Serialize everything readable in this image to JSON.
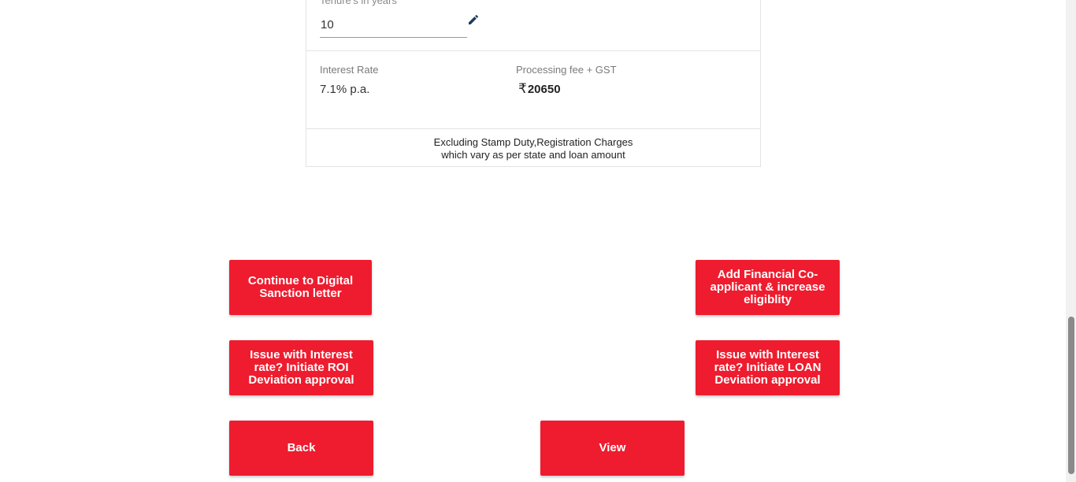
{
  "tenure": {
    "label": "Tenure's in years",
    "value": "10"
  },
  "interest": {
    "label": "Interest Rate",
    "value": "7.1% p.a."
  },
  "processing_fee": {
    "label": "Processing fee + GST",
    "currency_symbol": "₹",
    "value": "20650"
  },
  "note": {
    "line1": "Excluding Stamp Duty,Registration Charges",
    "line2": "which vary as per state and loan amount"
  },
  "actions": {
    "continue_label": "Continue to Digital Sanction letter",
    "add_coapplicant_label": "Add Financial Co-applicant & increase eligiblity",
    "roi_deviation_label": "Issue with Interest rate? Initiate ROI Deviation approval",
    "loan_deviation_label": "Issue with Interest rate? Initiate LOAN Deviation approval",
    "back_label": "Back",
    "view_label": "View"
  },
  "icons": {
    "edit": "pencil-icon"
  },
  "colors": {
    "accent": "#ee1c2e",
    "edit_icon": "#1d3b5e"
  }
}
